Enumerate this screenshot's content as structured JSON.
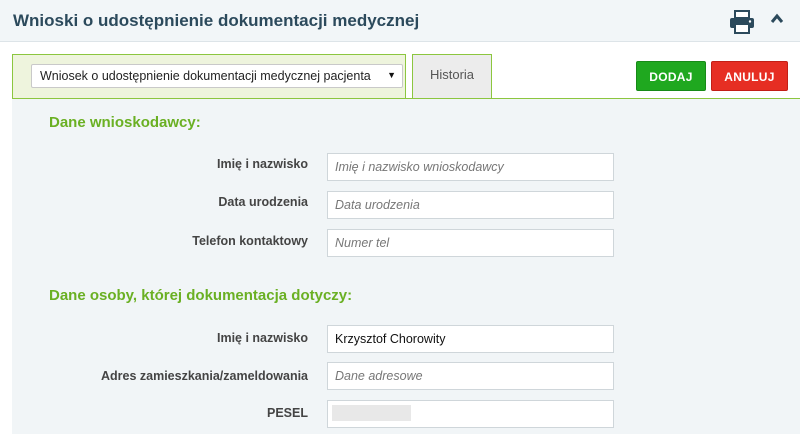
{
  "header": {
    "title": "Wnioski o udostępnienie dokumentacji medycznej",
    "icons": {
      "print": "print-icon",
      "collapse": "chevron-up-icon"
    }
  },
  "toolbar": {
    "select_value": "Wniosek o udostępnienie dokumentacji medycznej pacjenta",
    "history_tab": "Historia",
    "add_label": "DODAJ",
    "cancel_label": "ANULUJ"
  },
  "applicant": {
    "section_title": "Dane wnioskodawcy:",
    "name_label": "Imię i nazwisko",
    "name_placeholder": "Imię i nazwisko wnioskodawcy",
    "birth_label": "Data urodzenia",
    "birth_placeholder": "Data urodzenia",
    "phone_label": "Telefon kontaktowy",
    "phone_placeholder": "Numer tel"
  },
  "subject": {
    "section_title": "Dane osoby, której dokumentacja dotyczy:",
    "name_label": "Imię i nazwisko",
    "name_value": "Krzysztof Chorowity",
    "address_label": "Adres zamieszkania/zameldowania",
    "address_placeholder": "Dane adresowe",
    "pesel_label": "PESEL"
  },
  "colors": {
    "accent_green": "#6ab023",
    "add_button": "#1fa81f",
    "cancel_button": "#e62e23",
    "header_text": "#2c4a5c"
  }
}
